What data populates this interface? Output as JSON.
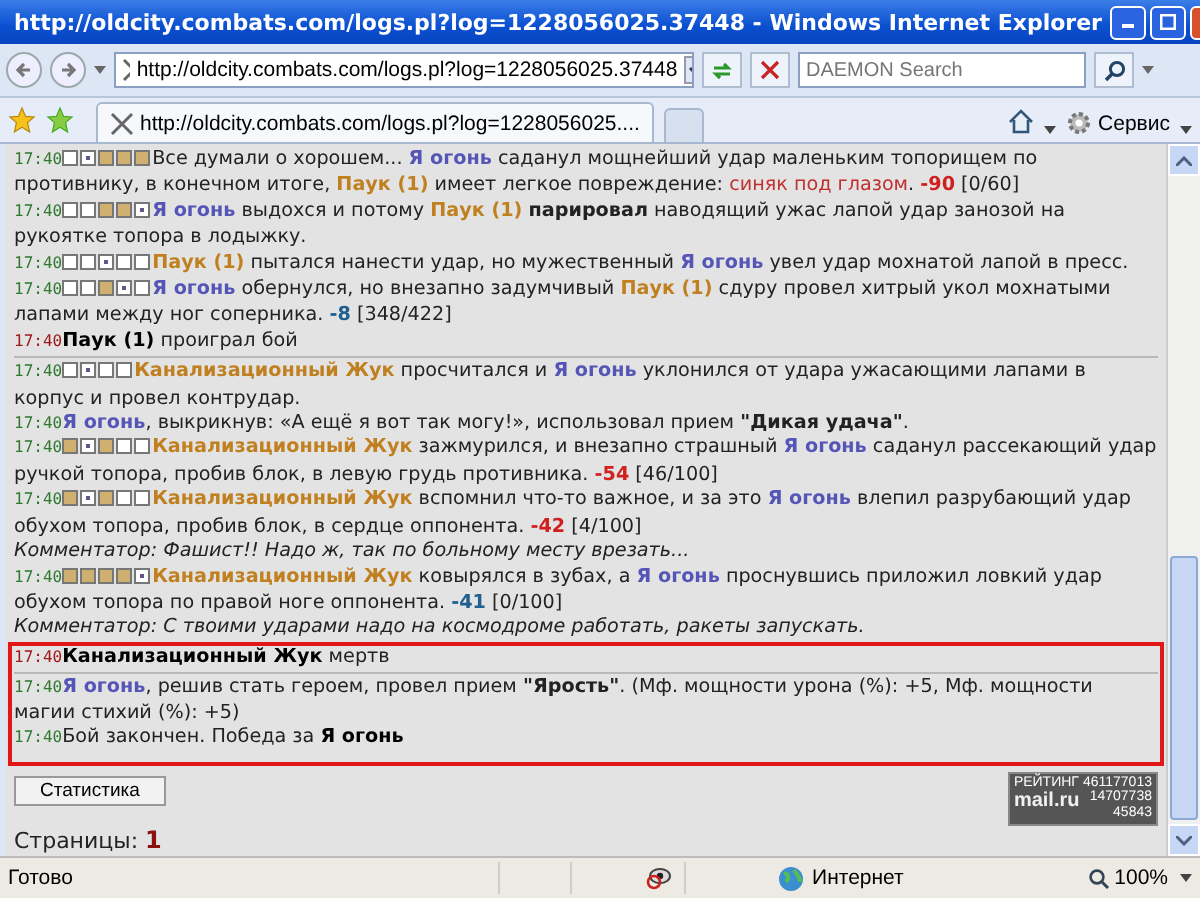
{
  "window": {
    "title": "http://oldcity.combats.com/logs.pl?log=1228056025.37448 - Windows Internet Explorer"
  },
  "address_bar": {
    "url": "http://oldcity.combats.com/logs.pl?log=1228056025.37448"
  },
  "search": {
    "placeholder": "DAEMON Search"
  },
  "tabs": [
    {
      "label": "http://oldcity.combats.com/logs.pl?log=1228056025....",
      "selected": true
    }
  ],
  "tools_menu": {
    "label": "Сервис"
  },
  "log": {
    "entries": [
      {
        "time": "17:40",
        "kind": "normal",
        "zones": [
          {
            "kind": "empty"
          },
          {
            "kind": "dot"
          },
          {
            "kind": "filled"
          },
          {
            "kind": "filled"
          },
          {
            "kind": "filled"
          }
        ],
        "divider_after": false,
        "segments": [
          {
            "kind": "text",
            "text": "Все думали о хорошем... "
          },
          {
            "kind": "me",
            "text": "Я огонь"
          },
          {
            "kind": "text",
            "text": " саданул мощнейший удар маленьким топорищем по противнику, в конечном итоге, "
          },
          {
            "kind": "enemy",
            "text": "Паук (1)"
          },
          {
            "kind": "text",
            "text": " имеет легкое повреждение: "
          },
          {
            "kind": "injury",
            "text": "синяк под глазом"
          },
          {
            "kind": "text",
            "text": ". "
          },
          {
            "kind": "damage",
            "text": "-90"
          },
          {
            "kind": "text",
            "text": " [0/60]"
          }
        ]
      },
      {
        "time": "17:40",
        "kind": "normal",
        "zones": [
          {
            "kind": "empty"
          },
          {
            "kind": "empty"
          },
          {
            "kind": "filled"
          },
          {
            "kind": "filled"
          },
          {
            "kind": "dot"
          }
        ],
        "divider_after": false,
        "segments": [
          {
            "kind": "me",
            "text": "Я огонь"
          },
          {
            "kind": "text",
            "text": " выдохся и потому "
          },
          {
            "kind": "enemy",
            "text": "Паук (1)"
          },
          {
            "kind": "text",
            "text": " **парировал** наводящий ужас лапой удар занозой на рукоятке топора в лодыжку."
          }
        ]
      },
      {
        "time": "17:40",
        "kind": "normal",
        "zones": [
          {
            "kind": "empty"
          },
          {
            "kind": "empty"
          },
          {
            "kind": "dot"
          },
          {
            "kind": "empty"
          },
          {
            "kind": "empty"
          }
        ],
        "divider_after": false,
        "segments": [
          {
            "kind": "enemy",
            "text": "Паук (1)"
          },
          {
            "kind": "text",
            "text": " пытался нанести удар, но мужественный "
          },
          {
            "kind": "me",
            "text": "Я огонь"
          },
          {
            "kind": "text",
            "text": " увел удар мохнатой лапой в пресс."
          }
        ]
      },
      {
        "time": "17:40",
        "kind": "normal",
        "zones": [
          {
            "kind": "empty"
          },
          {
            "kind": "empty"
          },
          {
            "kind": "filled"
          },
          {
            "kind": "dot"
          },
          {
            "kind": "empty"
          }
        ],
        "divider_after": false,
        "segments": [
          {
            "kind": "me",
            "text": "Я огонь"
          },
          {
            "kind": "text",
            "text": " обернулся, но внезапно задумчивый "
          },
          {
            "kind": "enemy",
            "text": "Паук (1)"
          },
          {
            "kind": "text",
            "text": " сдуру провел хитрый укол мохнатыми лапами между ног соперника. "
          },
          {
            "kind": "damage_blue",
            "text": "-8"
          },
          {
            "kind": "text",
            "text": " [348/422]"
          }
        ]
      },
      {
        "time": "17:40",
        "kind": "system",
        "divider_after": true,
        "segments": [
          {
            "kind": "bold",
            "text": "Паук (1)"
          },
          {
            "kind": "text",
            "text": " проиграл бой"
          }
        ]
      },
      {
        "time": "17:40",
        "kind": "normal",
        "zones": [
          {
            "kind": "empty"
          },
          {
            "kind": "dot"
          },
          {
            "kind": "empty"
          },
          {
            "kind": "empty"
          }
        ],
        "divider_after": false,
        "segments": [
          {
            "kind": "enemy",
            "text": "Канализационный Жук"
          },
          {
            "kind": "text",
            "text": " просчитался и "
          },
          {
            "kind": "me",
            "text": "Я огонь"
          },
          {
            "kind": "text",
            "text": " уклонился от удара ужасающими лапами в корпус и провел контрудар."
          }
        ]
      },
      {
        "time": "17:40",
        "kind": "normal",
        "divider_after": false,
        "segments": [
          {
            "kind": "me",
            "text": "Я огонь"
          },
          {
            "kind": "text",
            "text": ", выкрикнув: «А ещё я вот так могу!», использовал прием **\"Дикая удача\"**."
          }
        ]
      },
      {
        "time": "17:40",
        "kind": "normal",
        "zones": [
          {
            "kind": "filled"
          },
          {
            "kind": "dot"
          },
          {
            "kind": "filled"
          },
          {
            "kind": "empty"
          },
          {
            "kind": "empty"
          }
        ],
        "divider_after": false,
        "segments": [
          {
            "kind": "enemy",
            "text": "Канализационный Жук"
          },
          {
            "kind": "text",
            "text": " зажмурился, и внезапно страшный "
          },
          {
            "kind": "me",
            "text": "Я огонь"
          },
          {
            "kind": "text",
            "text": " саданул рассекающий удар ручкой топора, пробив блок, в левую грудь противника. "
          },
          {
            "kind": "damage",
            "text": "-54"
          },
          {
            "kind": "text",
            "text": " [46/100]"
          }
        ]
      },
      {
        "time": "17:40",
        "kind": "normal",
        "zones": [
          {
            "kind": "filled"
          },
          {
            "kind": "dot"
          },
          {
            "kind": "filled"
          },
          {
            "kind": "empty"
          },
          {
            "kind": "empty"
          }
        ],
        "divider_after": false,
        "segments": [
          {
            "kind": "enemy",
            "text": "Канализационный Жук"
          },
          {
            "kind": "text",
            "text": " вспомнил что-то важное, и за это "
          },
          {
            "kind": "me",
            "text": "Я огонь"
          },
          {
            "kind": "text",
            "text": " влепил разрубающий удар обухом топора, пробив блок, в сердце оппонента. "
          },
          {
            "kind": "damage",
            "text": "-42"
          },
          {
            "kind": "text",
            "text": " [4/100]"
          }
        ]
      },
      {
        "kind": "comment",
        "divider_after": false,
        "segments": [
          {
            "kind": "text",
            "text": "Комментатор: Фашист!! Надо ж, так по больному месту врезать..."
          }
        ]
      },
      {
        "time": "17:40",
        "kind": "normal",
        "zones": [
          {
            "kind": "filled"
          },
          {
            "kind": "filled"
          },
          {
            "kind": "filled"
          },
          {
            "kind": "filled"
          },
          {
            "kind": "dot"
          }
        ],
        "divider_after": false,
        "segments": [
          {
            "kind": "enemy",
            "text": "Канализационный Жук"
          },
          {
            "kind": "text",
            "text": " ковырялся в зубах, а "
          },
          {
            "kind": "me",
            "text": "Я огонь"
          },
          {
            "kind": "text",
            "text": " проснувшись приложил ловкий удар обухом топора по правой ноге оппонента. "
          },
          {
            "kind": "damage_blue",
            "text": "-41"
          },
          {
            "kind": "text",
            "text": " [0/100]"
          }
        ]
      },
      {
        "kind": "comment",
        "divider_after": false,
        "segments": [
          {
            "kind": "text",
            "text": "Комментатор: С твоими ударами надо на космодроме работать, ракеты запускать."
          }
        ]
      }
    ],
    "highlighted_entries": [
      {
        "time": "17:40",
        "kind": "system",
        "divider_after": true,
        "segments": [
          {
            "kind": "bold",
            "text": "Канализационный Жук"
          },
          {
            "kind": "text",
            "text": " мертв"
          }
        ]
      },
      {
        "time": "17:40",
        "kind": "normal",
        "divider_after": false,
        "segments": [
          {
            "kind": "me",
            "text": "Я огонь"
          },
          {
            "kind": "text",
            "text": ", решив стать героем, провел прием **\"Ярость\"**. (Мф. мощности урона (%): +5, Мф. мощности магии стихий (%): +5)"
          }
        ]
      },
      {
        "time": "17:40",
        "kind": "normal",
        "divider_after": false,
        "segments": [
          {
            "kind": "text",
            "text": "Бой закончен. Победа за "
          },
          {
            "kind": "bold",
            "text": "Я огонь"
          }
        ]
      }
    ]
  },
  "stats_button": {
    "label": "Статистика"
  },
  "counter": {
    "title": "РЕЙТИНГ",
    "number_1": "461177013",
    "brand": "mail.ru",
    "number_2": "14707738",
    "number_3": "45843"
  },
  "pages": {
    "label": "Страницы:",
    "current": "1"
  },
  "status_bar": {
    "status": "Готово",
    "zone": "Интернет",
    "zoom": "100%"
  }
}
